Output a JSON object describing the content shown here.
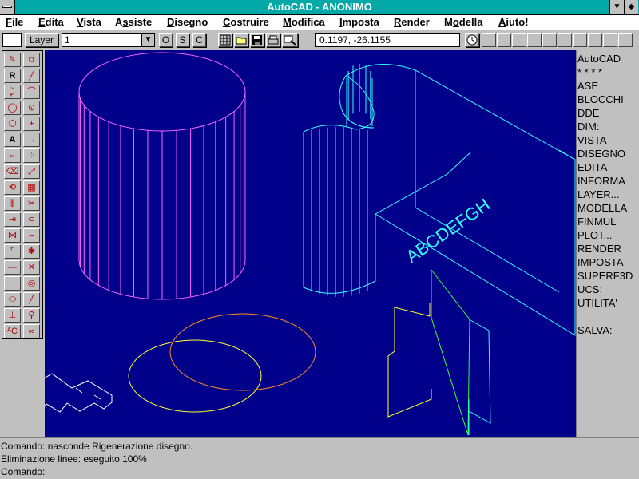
{
  "window": {
    "title": "AutoCAD - ANONIMO",
    "minimize_glyph": "▼",
    "maximize_glyph": "◆"
  },
  "menubar": {
    "items": [
      {
        "label": "File",
        "accel": "F"
      },
      {
        "label": "Edita",
        "accel": "E"
      },
      {
        "label": "Vista",
        "accel": "V"
      },
      {
        "label": "Assiste",
        "accel": "A"
      },
      {
        "label": "Disegno",
        "accel": "D"
      },
      {
        "label": "Costruire",
        "accel": "C"
      },
      {
        "label": "Modifica",
        "accel": "M"
      },
      {
        "label": "Imposta",
        "accel": "I"
      },
      {
        "label": "Render",
        "accel": "R"
      },
      {
        "label": "Modella",
        "accel": "M"
      },
      {
        "label": "Aiuto!",
        "accel": "A"
      }
    ]
  },
  "toolbar": {
    "layer_button": "Layer",
    "layer_value": "1",
    "ortho": "O",
    "snap": "S",
    "coords_toggle": "C",
    "coordinates": "0.1197,  -26.1155",
    "icons": [
      "grid-icon",
      "open-icon",
      "save-icon",
      "print-icon",
      "zoom-window-icon",
      "hourglass-icon"
    ]
  },
  "drawing": {
    "background": "#00008b",
    "text_on_wall": "ABCDEFGH",
    "colors": {
      "cylinder": "#ff66ff",
      "wall": "#33ffff",
      "ellipse_orange": "#ff8c1a",
      "ellipse_yellow": "#ffff33",
      "plane_yellow": "#ffff33",
      "plane_green": "#33ff33",
      "plane_cyan": "#33ffff",
      "ucs_icon": "#ffffff"
    }
  },
  "screen_menu": {
    "header": [
      "AutoCAD",
      "* * * *"
    ],
    "items": [
      "ASE",
      "BLOCCHI",
      "DDE",
      "DIM:",
      "VISTA",
      "DISEGNO",
      "EDITA",
      "INFORMA",
      "LAYER...",
      "MODELLA",
      "FINMUL",
      "PLOT...",
      "RENDER",
      "IMPOSTA",
      "SUPERF3D",
      "UCS:",
      "UTILITA'"
    ],
    "footer": "SALVA:"
  },
  "command": {
    "lines": [
      "Comando: nasconde Rigenerazione disegno.",
      "Eliminazione linee: eseguito 100%",
      "Comando:"
    ]
  },
  "palette": {
    "tools": [
      [
        "pencil-icon",
        "copy-icon"
      ],
      [
        "redraw-icon",
        "line-icon"
      ],
      [
        "pline-icon",
        "arc-icon"
      ],
      [
        "circle-icon",
        "ellipse-icon"
      ],
      [
        "polygon-icon",
        "point-icon"
      ],
      [
        "text-icon",
        "dimension-icon"
      ],
      [
        "move-icon",
        "array-icon"
      ],
      [
        "erase-icon",
        "scale-icon"
      ],
      [
        "rotate-icon",
        "hatch-icon"
      ],
      [
        "mirror-icon",
        "trim-icon"
      ],
      [
        "stretch-icon",
        "offset-icon"
      ],
      [
        "break-icon",
        "fillet-icon"
      ],
      [
        "chamfer-icon",
        "explode-icon"
      ],
      [
        "hide-icon",
        "cross-icon"
      ],
      [
        "xline-icon",
        "donut-icon"
      ],
      [
        "boundary-icon",
        "solid-icon"
      ],
      [
        "ucs-icon",
        "measure-icon"
      ],
      [
        "ddedit-icon",
        "link-icon"
      ]
    ]
  }
}
